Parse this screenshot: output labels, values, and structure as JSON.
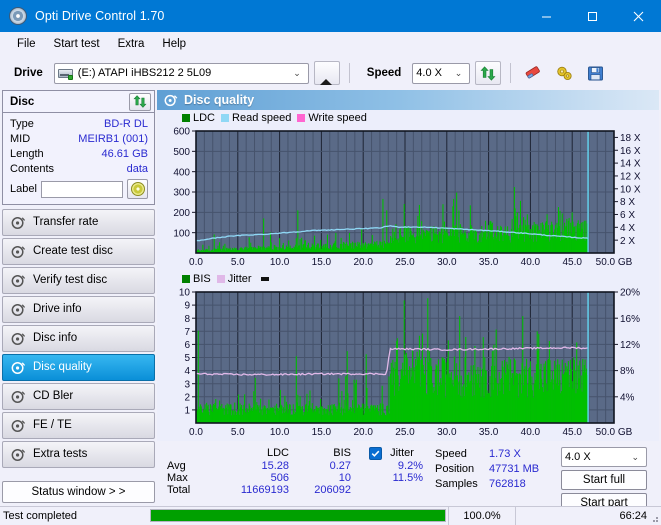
{
  "window": {
    "title": "Opti Drive Control 1.70",
    "app_icon": "disc-icon",
    "minimize": "–",
    "maximize": "□",
    "close": "✕"
  },
  "menubar": {
    "items": [
      "File",
      "Start test",
      "Extra",
      "Help"
    ]
  },
  "toolbar": {
    "drive_label": "Drive",
    "drive_value": "(E:)  ATAPI iHBS212  2 5L09",
    "eject_icon": "eject-icon",
    "speed_label": "Speed",
    "speed_value": "4.0 X",
    "refresh_icon": "refresh-icon",
    "erase_icon": "eraser-icon",
    "settings_icon": "gears-icon",
    "save_icon": "floppy-save-icon"
  },
  "sidebar": {
    "disc_panel": {
      "title": "Disc",
      "refresh_icon": "refresh-icon",
      "rows": [
        {
          "key": "Type",
          "value": "BD-R DL"
        },
        {
          "key": "MID",
          "value": "MEIRB1 (001)"
        },
        {
          "key": "Length",
          "value": "46.61 GB"
        },
        {
          "key": "Contents",
          "value": "data"
        }
      ],
      "label_key": "Label",
      "label_value": "",
      "label_placeholder": "",
      "disc_button_icon": "cd-icon"
    },
    "nav": [
      {
        "label": "Transfer rate",
        "icon": "disc-icon",
        "selected": false
      },
      {
        "label": "Create test disc",
        "icon": "disc-icon",
        "selected": false
      },
      {
        "label": "Verify test disc",
        "icon": "disc-icon",
        "selected": false
      },
      {
        "label": "Drive info",
        "icon": "disc-icon",
        "selected": false
      },
      {
        "label": "Disc info",
        "icon": "disc-icon",
        "selected": false
      },
      {
        "label": "Disc quality",
        "icon": "disc-icon",
        "selected": true
      },
      {
        "label": "CD Bler",
        "icon": "disc-icon",
        "selected": false
      },
      {
        "label": "FE / TE",
        "icon": "disc-icon",
        "selected": false
      },
      {
        "label": "Extra tests",
        "icon": "disc-icon",
        "selected": false
      }
    ],
    "status_window_button": "Status window > >"
  },
  "panel": {
    "header_title": "Disc quality",
    "header_icon": "disc-icon"
  },
  "stats": {
    "col_headers": [
      "",
      "LDC",
      "BIS",
      "Jitter"
    ],
    "jitter_checkbox_checked": true,
    "jitter_label": "Jitter",
    "rows": [
      {
        "name": "Avg",
        "ldc": "15.28",
        "bis": "0.27",
        "jitter": "9.2%"
      },
      {
        "name": "Max",
        "ldc": "506",
        "bis": "10",
        "jitter": "11.5%"
      },
      {
        "name": "Total",
        "ldc": "11669193",
        "bis": "206092",
        "jitter": ""
      }
    ],
    "info": [
      {
        "key": "Speed",
        "value": "1.73 X"
      },
      {
        "key": "Position",
        "value": "47731 MB"
      },
      {
        "key": "Samples",
        "value": "762818"
      }
    ],
    "speed_select": "4.0 X",
    "start_full_button": "Start full",
    "start_part_button": "Start part"
  },
  "statusbar": {
    "message": "Test completed",
    "progress_percent": "100.0%",
    "progress_value": 100,
    "elapsed": "66:24"
  },
  "colors": {
    "accent": "#0078d4",
    "plot_bg": "#5a6a87",
    "ldc_green": "#00c000",
    "bis_green": "#00c000",
    "read_speed": "#8fd8f5",
    "write_speed": "#ff66d0",
    "jitter": "#e0b8e8",
    "value_blue": "#2a2ad0",
    "progress_green": "#00a000"
  },
  "chart_data": [
    {
      "type": "area",
      "name": "Disc quality - LDC",
      "title": "",
      "xlabel": "GB",
      "ylabel": "",
      "xlim": [
        0,
        50
      ],
      "ylim": [
        0,
        600
      ],
      "y2lim": [
        0,
        18
      ],
      "y2label": "X",
      "grid": true,
      "legend_position": "top-left",
      "legend": [
        "LDC",
        "Read speed",
        "Write speed"
      ],
      "xticks": [
        "0.0",
        "5.0",
        "10.0",
        "15.0",
        "20.0",
        "25.0",
        "30.0",
        "35.0",
        "40.0",
        "45.0",
        "50.0 GB"
      ],
      "yticks": [
        100,
        200,
        300,
        400,
        500,
        600
      ],
      "y2ticks": [
        "2 X",
        "4 X",
        "6 X",
        "8 X",
        "10 X",
        "12 X",
        "14 X",
        "16 X",
        "18 X"
      ],
      "series": [
        {
          "name": "LDC",
          "color": "#00c000",
          "kind": "impulse",
          "x": [
            0.2,
            0.5,
            0.8,
            1.1,
            1.4,
            1.7,
            2.0,
            2.3,
            2.6,
            2.9,
            3.2,
            3.5,
            3.8,
            4.1,
            4.4,
            4.7,
            5.0,
            5.3,
            5.6,
            5.9,
            6.2,
            6.5,
            6.8,
            7.1,
            7.4,
            7.7,
            8.0,
            8.3,
            8.6,
            8.9,
            9.2,
            9.5,
            9.8,
            10.1,
            10.4,
            10.7,
            11.0,
            11.3,
            11.6,
            11.9,
            12.2,
            12.5,
            12.8,
            13.1,
            13.4,
            13.7,
            14.0,
            14.3,
            14.6,
            14.9,
            15.2,
            15.5,
            15.8,
            16.1,
            16.4,
            16.7,
            17.0,
            17.3,
            17.6,
            17.9,
            18.2,
            18.5,
            18.8,
            19.1,
            19.4,
            19.7,
            20.0,
            20.3,
            20.6,
            20.9,
            21.2,
            21.5,
            21.8,
            22.1,
            22.4,
            22.7,
            23.0,
            23.3,
            23.6,
            23.9,
            24.2,
            24.5,
            24.8,
            25.1,
            25.4,
            25.7,
            26.0,
            26.3,
            26.6,
            26.9,
            27.2,
            27.5,
            27.8,
            28.1,
            28.4,
            28.7,
            29.0,
            29.3,
            29.6,
            29.9,
            30.2,
            30.5,
            30.8,
            31.1,
            31.4,
            31.7,
            32.0,
            32.3,
            32.6,
            32.9,
            33.2,
            33.5,
            33.8,
            34.1,
            34.4,
            34.7,
            35.0,
            35.3,
            35.6,
            35.9,
            36.2,
            36.5,
            36.8,
            37.1,
            37.4,
            37.7,
            38.0,
            38.3,
            38.6,
            38.9,
            39.2,
            39.5,
            39.8,
            40.1,
            40.4,
            40.7,
            41.0,
            41.3,
            41.6,
            41.9,
            42.2,
            42.5,
            42.8,
            43.1,
            43.4,
            43.7,
            44.0,
            44.3,
            44.6,
            44.9,
            45.2,
            45.5,
            45.8,
            46.1,
            46.4,
            46.7
          ],
          "y": [
            302,
            60,
            45,
            120,
            38,
            55,
            255,
            48,
            42,
            70,
            35,
            52,
            40,
            62,
            45,
            38,
            150,
            42,
            58,
            40,
            36,
            95,
            44,
            52,
            38,
            60,
            175,
            48,
            40,
            145,
            42,
            55,
            38,
            125,
            46,
            40,
            88,
            50,
            42,
            110,
            255,
            48,
            230,
            44,
            38,
            140,
            315,
            52,
            46,
            98,
            60,
            44,
            120,
            38,
            168,
            50,
            505,
            42,
            260,
            46,
            230,
            38,
            120,
            52,
            44,
            175,
            130,
            48,
            205,
            42,
            195,
            330,
            58,
            355,
            310,
            240,
            430,
            300,
            195,
            180,
            440,
            320,
            215,
            270,
            175,
            340,
            225,
            160,
            310,
            250,
            200,
            185,
            340,
            290,
            225,
            340,
            210,
            335,
            185,
            265,
            240,
            170,
            305,
            455,
            260,
            200,
            190,
            320,
            300,
            230,
            215,
            180,
            250,
            195,
            300,
            230,
            175,
            260,
            205,
            190,
            230,
            170,
            300,
            245,
            180,
            210,
            305,
            195,
            160,
            250,
            220,
            185,
            240,
            175,
            195,
            320,
            400,
            230,
            170,
            215,
            190,
            260,
            175,
            195,
            310,
            250,
            200,
            240,
            175,
            300,
            210,
            165,
            230,
            190
          ]
        },
        {
          "name": "Read speed",
          "color": "#8fd8f5",
          "kind": "line",
          "x": [
            0.2,
            2,
            4,
            6,
            8,
            10,
            12,
            14,
            16,
            18,
            20,
            22,
            23.2,
            24,
            26,
            28,
            30,
            32,
            34,
            36,
            38,
            40,
            42,
            44,
            46,
            46.9
          ],
          "y_x_units": [
            1.9,
            2.3,
            2.6,
            2.8,
            2.9,
            3.1,
            3.3,
            3.5,
            3.6,
            3.7,
            3.8,
            3.9,
            4.25,
            4.05,
            4.05,
            4.0,
            3.85,
            3.7,
            3.55,
            3.4,
            3.2,
            3.0,
            2.75,
            2.55,
            2.35,
            2.3
          ]
        },
        {
          "name": "Write speed",
          "color": "#ff66d0",
          "kind": "line",
          "x": [],
          "y": []
        },
        {
          "name": "end-marker",
          "color": "#8fd8f5",
          "kind": "vline",
          "x": 46.9
        }
      ]
    },
    {
      "type": "area",
      "name": "Disc quality - BIS / Jitter",
      "title": "",
      "xlabel": "GB",
      "ylabel": "",
      "xlim": [
        0,
        50
      ],
      "ylim": [
        0,
        10
      ],
      "y2lim": [
        0,
        20
      ],
      "y2label": "%",
      "grid": true,
      "legend_position": "top-left",
      "legend": [
        "BIS",
        "Jitter"
      ],
      "xticks": [
        "0.0",
        "5.0",
        "10.0",
        "15.0",
        "20.0",
        "25.0",
        "30.0",
        "35.0",
        "40.0",
        "45.0",
        "50.0 GB"
      ],
      "yticks": [
        1,
        2,
        3,
        4,
        5,
        6,
        7,
        8,
        9,
        10
      ],
      "y2ticks": [
        "4%",
        "8%",
        "12%",
        "16%",
        "20%"
      ],
      "series": [
        {
          "name": "BIS",
          "color": "#00c000",
          "kind": "impulse",
          "note": "dense band; baseline ~1 before 23.2 GB, ~3-4 after, with spikes to 6-10",
          "x": [
            0.2,
            0.6,
            1.0,
            1.4,
            1.8,
            2.2,
            2.6,
            3.0,
            3.4,
            3.8,
            4.2,
            4.6,
            5.0,
            5.4,
            5.8,
            6.2,
            6.6,
            7.0,
            7.4,
            7.8,
            8.2,
            8.6,
            9.0,
            9.4,
            9.8,
            10.2,
            10.6,
            11.0,
            11.4,
            11.8,
            12.2,
            12.6,
            13.0,
            13.4,
            13.8,
            14.2,
            14.6,
            15.0,
            15.4,
            15.8,
            16.2,
            16.6,
            17.0,
            17.4,
            17.8,
            18.2,
            18.6,
            19.0,
            19.4,
            19.8,
            20.2,
            20.6,
            21.0,
            21.4,
            21.8,
            22.2,
            22.6,
            23.0,
            23.4,
            23.8,
            24.2,
            24.6,
            25.0,
            25.4,
            25.8,
            26.2,
            26.6,
            27.0,
            27.4,
            27.8,
            28.2,
            28.6,
            29.0,
            29.4,
            29.8,
            30.2,
            30.6,
            31.0,
            31.4,
            31.8,
            32.2,
            32.6,
            33.0,
            33.4,
            33.8,
            34.2,
            34.6,
            35.0,
            35.4,
            35.8,
            36.2,
            36.6,
            37.0,
            37.4,
            37.8,
            38.2,
            38.6,
            39.0,
            39.4,
            39.8,
            40.2,
            40.6,
            41.0,
            41.4,
            41.8,
            42.2,
            42.6,
            43.0,
            43.4,
            43.8,
            44.2,
            44.6,
            45.0,
            45.4,
            45.8,
            46.2,
            46.6
          ],
          "y": [
            6,
            2,
            1,
            2,
            1,
            3,
            1,
            2,
            1,
            1,
            2,
            1,
            3,
            1,
            2,
            1,
            1,
            4,
            1,
            2,
            1,
            3,
            1,
            2,
            1,
            6,
            2,
            1,
            3,
            1,
            7,
            2,
            1,
            4,
            1,
            2,
            6,
            1,
            3,
            1,
            2,
            1,
            4,
            1,
            10,
            2,
            1,
            6,
            2,
            1,
            7,
            1,
            2,
            3,
            1,
            5,
            1,
            8,
            4,
            6,
            8,
            5,
            9,
            4,
            6,
            8,
            5,
            7,
            4,
            8,
            5,
            6,
            4,
            7,
            5,
            8,
            4,
            6,
            9,
            5,
            7,
            4,
            6,
            8,
            5,
            7,
            4,
            6,
            5,
            8,
            4,
            7,
            5,
            6,
            4,
            8,
            5,
            7,
            4,
            6,
            9,
            5,
            7,
            4,
            6,
            8,
            5,
            7,
            4,
            8,
            5,
            6,
            4,
            7,
            5,
            6,
            4
          ]
        },
        {
          "name": "Jitter",
          "color": "#e0b8e8",
          "kind": "line",
          "x": [
            0.2,
            5,
            10,
            15,
            20,
            22.8,
            23.2,
            25,
            30,
            35,
            40,
            45,
            46.9
          ],
          "y_percent": [
            7.5,
            7.4,
            7.4,
            7.5,
            7.5,
            7.5,
            11.3,
            11.3,
            11.2,
            11.3,
            11.4,
            11.5,
            11.4
          ]
        },
        {
          "name": "end-marker",
          "color": "#66d8f5",
          "kind": "vline",
          "x": 46.9
        }
      ]
    }
  ]
}
